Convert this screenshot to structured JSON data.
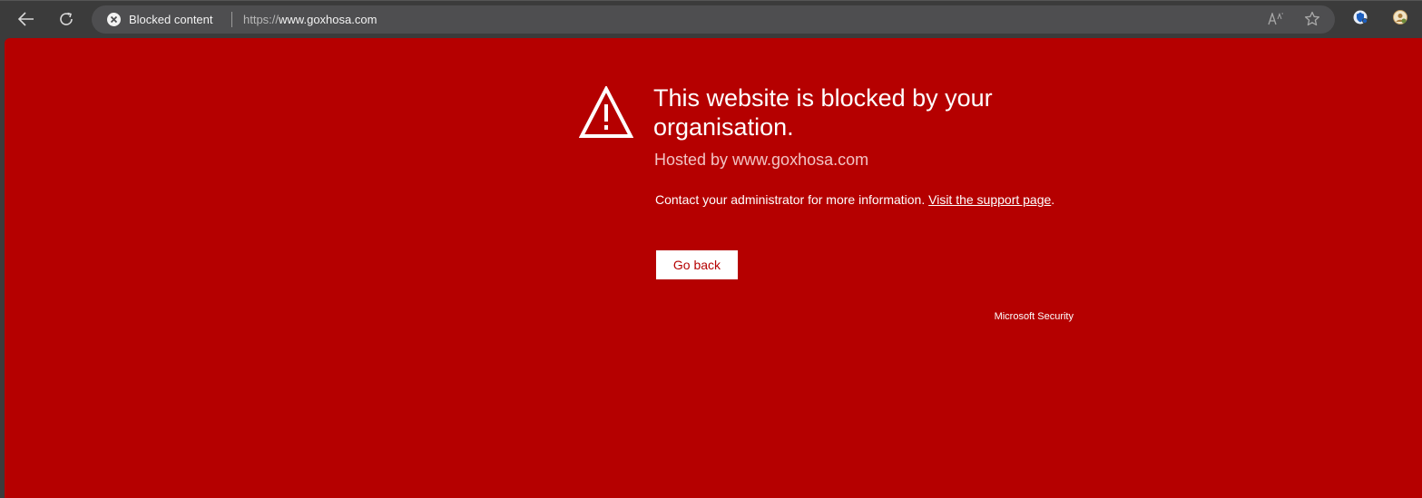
{
  "toolbar": {
    "back_icon": "back-arrow-icon",
    "refresh_icon": "refresh-icon",
    "site_info_label": "Blocked content",
    "site_info_icon": "blocked-x-icon",
    "url_scheme": "https://",
    "url_host": "www.goxhosa.com",
    "read_aloud_icon": "read-aloud-icon",
    "read_aloud_glyph": "A̅̇",
    "favorite_icon": "star-icon",
    "extensions": [
      "extension-shield-icon",
      "extension-profile-icon"
    ]
  },
  "page": {
    "warning_icon": "warning-triangle-icon",
    "headline": "This website is blocked by your organisation.",
    "hosted_by": "Hosted by www.goxhosa.com",
    "description_text": "Contact your administrator for more information. ",
    "support_link_text": "Visit the support page",
    "description_end": ".",
    "go_back_label": "Go back",
    "brand": "Microsoft Security"
  },
  "colors": {
    "background": "#b50000",
    "toolbar": "#3b3b3b",
    "omnibox": "#4e4e50",
    "button_bg": "#ffffff",
    "button_text": "#b50000"
  }
}
